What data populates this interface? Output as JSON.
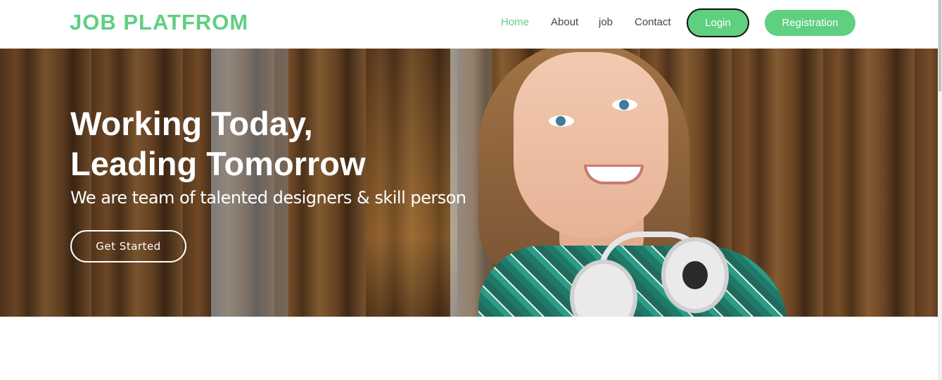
{
  "brand": {
    "name": "JOB PLATFROM",
    "color": "#5fcf80"
  },
  "nav": {
    "items": [
      {
        "label": "Home",
        "active": true
      },
      {
        "label": "About",
        "active": false
      },
      {
        "label": "job",
        "active": false
      },
      {
        "label": "Contact",
        "active": false
      }
    ],
    "login_label": "Login",
    "registration_label": "Registration"
  },
  "hero": {
    "title": "Working Today,\nLeading Tomorrow",
    "subtitle": "We are team of talented designers & skill person",
    "cta_label": "Get Started"
  },
  "colors": {
    "accent": "#5fcf80",
    "nav_text": "#444444",
    "hero_text": "#ffffff"
  }
}
